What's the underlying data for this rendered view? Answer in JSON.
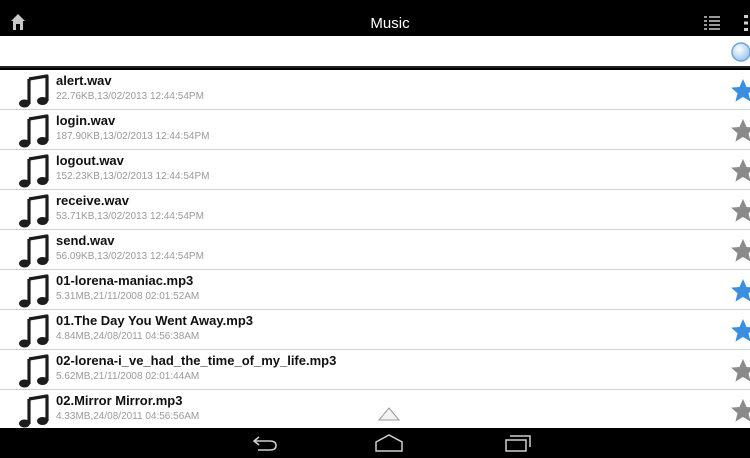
{
  "header": {
    "title": "Music",
    "home_icon": "home-icon",
    "list_icon": "list-view-icon",
    "more_icon": "overflow-menu-icon"
  },
  "search": {
    "value": "",
    "icon": "search-icon"
  },
  "files": [
    {
      "name": "alert.wav",
      "meta": "22.76KB,13/02/2013 12:44:54PM",
      "favorite": true
    },
    {
      "name": "login.wav",
      "meta": "187.90KB,13/02/2013 12:44:54PM",
      "favorite": false
    },
    {
      "name": "logout.wav",
      "meta": "152.23KB,13/02/2013 12:44:54PM",
      "favorite": false
    },
    {
      "name": "receive.wav",
      "meta": "53.71KB,13/02/2013 12:44:54PM",
      "favorite": false
    },
    {
      "name": "send.wav",
      "meta": "56.09KB,13/02/2013 12:44:54PM",
      "favorite": false
    },
    {
      "name": "01-lorena-maniac.mp3",
      "meta": "5.31MB,21/11/2008 02:01:52AM",
      "favorite": true
    },
    {
      "name": "01.The Day You Went Away.mp3",
      "meta": "4.84MB,24/08/2011 04:56:38AM",
      "favorite": true
    },
    {
      "name": "02-lorena-i_ve_had_the_time_of_my_life.mp3",
      "meta": "5.62MB,21/11/2008 02:01:44AM",
      "favorite": false
    },
    {
      "name": "02.Mirror Mirror.mp3",
      "meta": "4.33MB,24/08/2011 04:56:56AM",
      "favorite": false
    }
  ],
  "colors": {
    "favorite_star": "#3b8fe0",
    "normal_star": "#8a8a8a",
    "meta_text": "#9a9a9a"
  },
  "navbar": {
    "back_icon": "back-icon",
    "home_icon": "home-nav-icon",
    "recents_icon": "recent-apps-icon"
  }
}
